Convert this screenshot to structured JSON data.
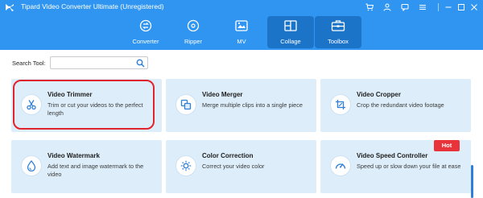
{
  "app": {
    "title": "Tipard Video Converter Ultimate (Unregistered)"
  },
  "title_icons": [
    "cart-icon",
    "user-icon",
    "chat-icon",
    "menu-icon",
    "minimize-icon",
    "restore-icon",
    "close-icon"
  ],
  "tabs": [
    {
      "label": "Converter",
      "icon": "converter-icon",
      "active": false
    },
    {
      "label": "Ripper",
      "icon": "ripper-icon",
      "active": false
    },
    {
      "label": "MV",
      "icon": "mv-icon",
      "active": false
    },
    {
      "label": "Collage",
      "icon": "collage-icon",
      "active": true
    },
    {
      "label": "Toolbox",
      "icon": "toolbox-icon",
      "active": true
    }
  ],
  "search": {
    "label": "Search Tool:",
    "value": "",
    "placeholder": ""
  },
  "tools": [
    {
      "title": "Video Trimmer",
      "desc": "Trim or cut your videos to the perfect length",
      "icon": "scissors-icon",
      "highlighted": true
    },
    {
      "title": "Video Merger",
      "desc": "Merge multiple clips into a single piece",
      "icon": "merge-icon"
    },
    {
      "title": "Video Cropper",
      "desc": "Crop the redundant video footage",
      "icon": "crop-icon"
    },
    {
      "title": "Video Watermark",
      "desc": "Add text and image watermark to the video",
      "icon": "droplet-icon"
    },
    {
      "title": "Color Correction",
      "desc": "Correct your video color",
      "icon": "sun-icon"
    },
    {
      "title": "Video Speed Controller",
      "desc": "Speed up or slow down your file at ease",
      "icon": "speedometer-icon",
      "badge": "Hot"
    }
  ],
  "colors": {
    "header": "#2f95f0",
    "active_tab": "#1c74c8",
    "card": "#ddeefa",
    "highlight": "#e0232c",
    "badge": "#e8333a"
  }
}
